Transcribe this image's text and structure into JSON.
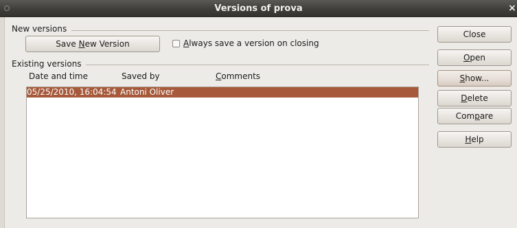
{
  "window": {
    "title": "Versions of prova",
    "close_glyph": "×"
  },
  "new_versions": {
    "section_label": "New versions",
    "save_button": {
      "before": "Save ",
      "accel": "N",
      "after": "ew Version"
    },
    "always_save_checkbox": {
      "checked": false,
      "accel": "A",
      "label_rest": "lways save a version on closing"
    }
  },
  "existing_versions": {
    "section_label": "Existing versions",
    "columns": {
      "date": "Date and time",
      "saved_by": "Saved by",
      "comments_accel": "C",
      "comments_rest": "omments"
    },
    "rows": [
      {
        "date": "05/25/2010, 16:04:54",
        "saved_by": "Antoni Oliver",
        "comments": "",
        "selected": true
      }
    ]
  },
  "side_buttons": {
    "close": {
      "before": "Close",
      "accel": "",
      "after": ""
    },
    "open": {
      "before": "",
      "accel": "O",
      "after": "pen"
    },
    "show": {
      "before": "",
      "accel": "S",
      "after": "how..."
    },
    "delete": {
      "before": "",
      "accel": "D",
      "after": "elete"
    },
    "compare": {
      "before": "Com",
      "accel": "p",
      "after": "are"
    },
    "help": {
      "before": "",
      "accel": "H",
      "after": "elp"
    }
  },
  "colors": {
    "selection": "#a6593b",
    "titlebar": "#3f3e3a",
    "dialog_bg": "#edebe7"
  }
}
